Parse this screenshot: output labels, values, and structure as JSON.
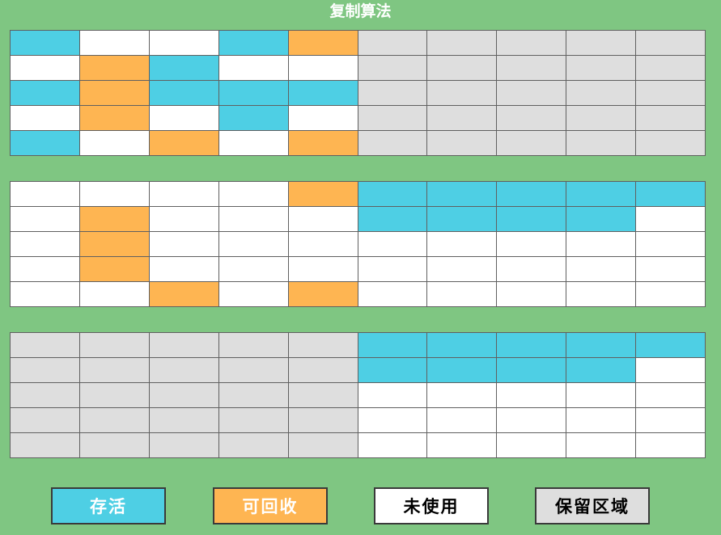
{
  "title": "复制算法",
  "colors": {
    "background": "#7fc682",
    "live": "#4ecfe4",
    "recyclable": "#feb552",
    "unused": "#ffffff",
    "reserved": "#dedede",
    "border": "#606060"
  },
  "legend": [
    {
      "key": "live",
      "label": "存活",
      "text_color": "#ffffff"
    },
    {
      "key": "recyclable",
      "label": "可回收",
      "text_color": "#ffffff"
    },
    {
      "key": "unused",
      "label": "未使用",
      "text_color": "#000000"
    },
    {
      "key": "reserved",
      "label": "保留区域",
      "text_color": "#000000"
    }
  ],
  "grids": [
    {
      "name": "before-gc",
      "rows": [
        [
          "live",
          "unused",
          "unused",
          "live",
          "recyclable",
          "reserved",
          "reserved",
          "reserved",
          "reserved",
          "reserved"
        ],
        [
          "unused",
          "recyclable",
          "live",
          "unused",
          "unused",
          "reserved",
          "reserved",
          "reserved",
          "reserved",
          "reserved"
        ],
        [
          "live",
          "recyclable",
          "live",
          "live",
          "live",
          "reserved",
          "reserved",
          "reserved",
          "reserved",
          "reserved"
        ],
        [
          "unused",
          "recyclable",
          "unused",
          "live",
          "unused",
          "reserved",
          "reserved",
          "reserved",
          "reserved",
          "reserved"
        ],
        [
          "live",
          "unused",
          "recyclable",
          "unused",
          "recyclable",
          "reserved",
          "reserved",
          "reserved",
          "reserved",
          "reserved"
        ]
      ]
    },
    {
      "name": "during-copy",
      "rows": [
        [
          "unused",
          "unused",
          "unused",
          "unused",
          "recyclable",
          "live",
          "live",
          "live",
          "live",
          "live"
        ],
        [
          "unused",
          "recyclable",
          "unused",
          "unused",
          "unused",
          "live",
          "live",
          "live",
          "live",
          "unused"
        ],
        [
          "unused",
          "recyclable",
          "unused",
          "unused",
          "unused",
          "unused",
          "unused",
          "unused",
          "unused",
          "unused"
        ],
        [
          "unused",
          "recyclable",
          "unused",
          "unused",
          "unused",
          "unused",
          "unused",
          "unused",
          "unused",
          "unused"
        ],
        [
          "unused",
          "unused",
          "recyclable",
          "unused",
          "recyclable",
          "unused",
          "unused",
          "unused",
          "unused",
          "unused"
        ]
      ]
    },
    {
      "name": "after-gc",
      "rows": [
        [
          "reserved",
          "reserved",
          "reserved",
          "reserved",
          "reserved",
          "live",
          "live",
          "live",
          "live",
          "live"
        ],
        [
          "reserved",
          "reserved",
          "reserved",
          "reserved",
          "reserved",
          "live",
          "live",
          "live",
          "live",
          "unused"
        ],
        [
          "reserved",
          "reserved",
          "reserved",
          "reserved",
          "reserved",
          "unused",
          "unused",
          "unused",
          "unused",
          "unused"
        ],
        [
          "reserved",
          "reserved",
          "reserved",
          "reserved",
          "reserved",
          "unused",
          "unused",
          "unused",
          "unused",
          "unused"
        ],
        [
          "reserved",
          "reserved",
          "reserved",
          "reserved",
          "reserved",
          "unused",
          "unused",
          "unused",
          "unused",
          "unused"
        ]
      ]
    }
  ]
}
